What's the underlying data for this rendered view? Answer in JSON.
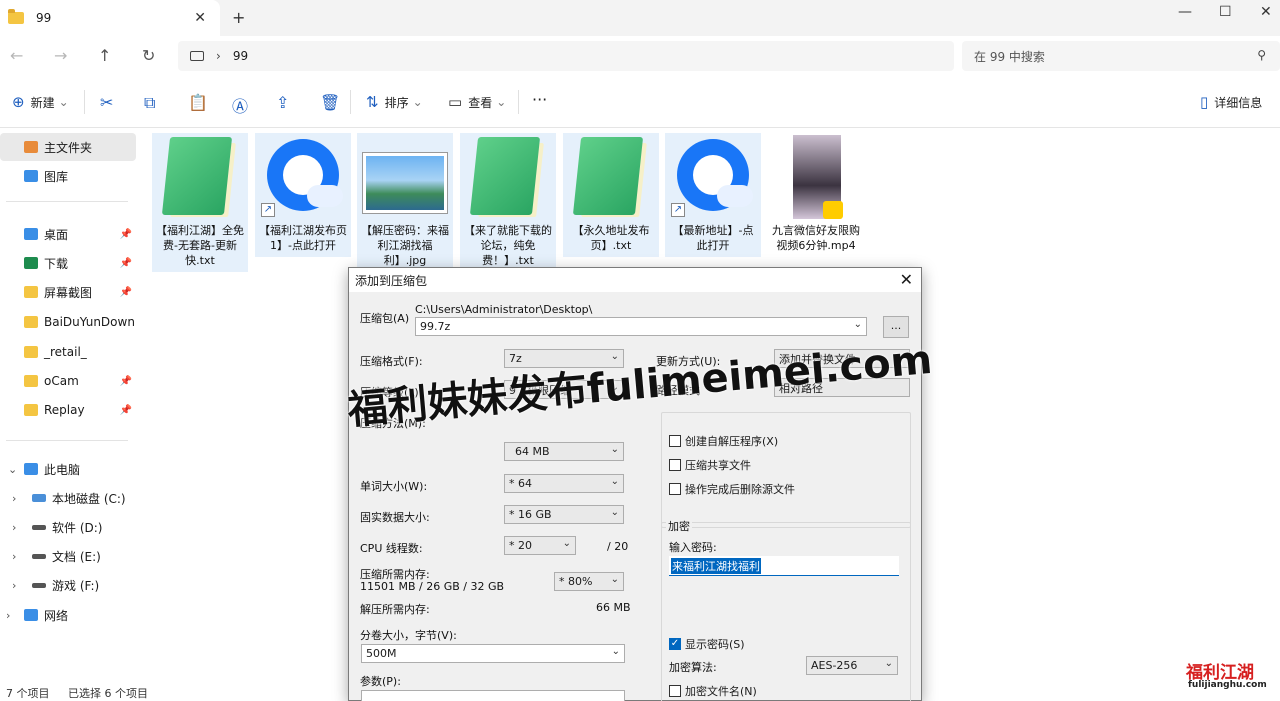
{
  "window": {
    "tab_title": "99",
    "tab_close": "✕",
    "new_tab": "+",
    "minimize": "—",
    "maximize": "☐",
    "close": "✕"
  },
  "nav": {
    "back": "←",
    "forward": "→",
    "up": "↑",
    "refresh": "↻",
    "breadcrumb_sep": "›",
    "breadcrumb": "99",
    "search_placeholder": "在 99 中搜索"
  },
  "toolbar": {
    "new_label": "新建",
    "new_caret": "⌄",
    "sort_label": "排序",
    "view_label": "查看",
    "more": "···",
    "details_label": "详细信息"
  },
  "sidebar": {
    "home": "主文件夹",
    "gallery": "图库",
    "quick": [
      {
        "label": "桌面",
        "pinned": true,
        "color": "#3a8ee6"
      },
      {
        "label": "下载",
        "pinned": true,
        "color": "#1e8c4e"
      },
      {
        "label": "屏幕截图",
        "pinned": true,
        "color": "#f4c542"
      },
      {
        "label": "BaiDuYunDownload",
        "pinned": false,
        "color": "#f4c542"
      },
      {
        "label": "_retail_",
        "pinned": false,
        "color": "#f4c542"
      },
      {
        "label": "oCam",
        "pinned": true,
        "color": "#f4c542"
      },
      {
        "label": "Replay",
        "pinned": true,
        "color": "#f4c542"
      }
    ],
    "this_pc": "此电脑",
    "drives": [
      {
        "label": "本地磁盘 (C:)"
      },
      {
        "label": "软件 (D:)"
      },
      {
        "label": "文档 (E:)"
      },
      {
        "label": "游戏 (F:)"
      }
    ],
    "network": "网络",
    "pin_glyph": "📌"
  },
  "files": [
    {
      "name": "【福利江湖】全免费-无套路-更新快.txt",
      "icon": "notepad-icon",
      "selected": true
    },
    {
      "name": "【福利江湖发布页1】-点此打开",
      "icon": "qq-browser-icon",
      "selected": true
    },
    {
      "name": "【解压密码：来福利江湖找福利】.jpg",
      "icon": "image-icon",
      "selected": true
    },
    {
      "name": "【来了就能下载的论坛，纯免费！】.txt",
      "icon": "notepad-icon",
      "selected": true
    },
    {
      "name": "【永久地址发布页】.txt",
      "icon": "notepad-icon",
      "selected": true
    },
    {
      "name": "【最新地址】-点此打开",
      "icon": "qq-browser-icon",
      "selected": true
    },
    {
      "name": "九言微信好友限购视频6分钟.mp4",
      "icon": "video-icon",
      "selected": false
    }
  ],
  "dialog": {
    "title": "添加到压缩包",
    "close": "✕",
    "archive_label": "压缩包(A)",
    "archive_dir": "C:\\Users\\Administrator\\Desktop\\",
    "archive_name": "99.7z",
    "browse": "...",
    "format_label": "压缩格式(F):",
    "format_value": "7z",
    "level_label": "压缩等级(L):",
    "level_value": "9 - 极限压缩",
    "method_label": "压缩方法(M):",
    "dict_value": "64 MB",
    "word_label": "单词大小(W):",
    "word_value": "* 64",
    "solid_label": "固实数据大小:",
    "solid_value": "* 16 GB",
    "cpu_label": "CPU 线程数:",
    "cpu_value": "* 20",
    "cpu_total": "/ 20",
    "mem_label": "压缩所需内存:",
    "mem_detail": "11501 MB / 26 GB / 32 GB",
    "mem_value": "* 80%",
    "decomp_label": "解压所需内存:",
    "decomp_value": "66 MB",
    "split_label": "分卷大小，字节(V):",
    "split_value": "500M",
    "params_label": "参数(P):",
    "update_label": "更新方式(U):",
    "update_value": "添加并替换文件",
    "path_label": "路径模式",
    "path_value": "相对路径",
    "opt_sfx": "创建自解压程序(X)",
    "opt_shared": "压缩共享文件",
    "opt_delete": "操作完成后删除源文件",
    "enc_group": "加密",
    "enc_pwd_label": "输入密码:",
    "enc_pwd_value": "来福利江湖找福利",
    "show_pwd": "显示密码(S)",
    "enc_method_label": "加密算法:",
    "enc_method_value": "AES-256",
    "enc_names": "加密文件名(N)"
  },
  "watermark": "福利妹妹发布fulimeimei.com",
  "status": {
    "count": "7 个项目",
    "selected": "已选择 6 个项目"
  },
  "logo": {
    "title": "福利江湖",
    "url": "fulijianghu.com"
  }
}
